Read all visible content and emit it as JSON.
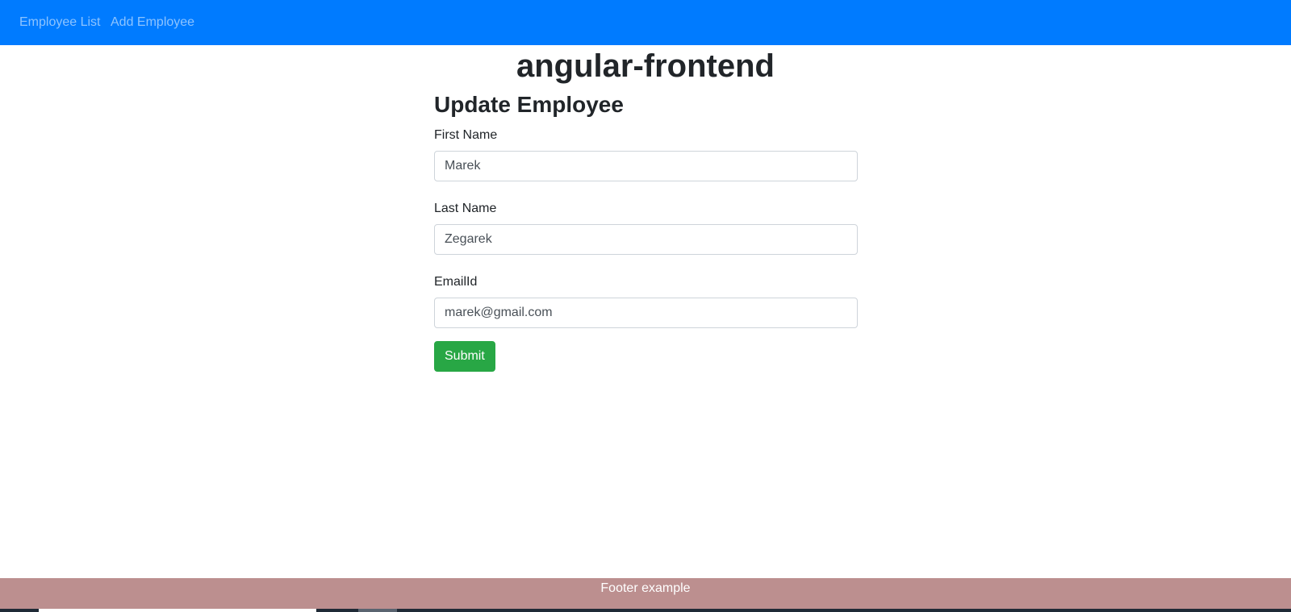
{
  "navbar": {
    "links": [
      {
        "label": "Employee List"
      },
      {
        "label": "Add Employee"
      }
    ],
    "color": "#007bff"
  },
  "app": {
    "title": "angular-frontend"
  },
  "form": {
    "heading": "Update Employee",
    "fields": [
      {
        "label": "First Name",
        "value": "Marek"
      },
      {
        "label": "Last Name",
        "value": "Zegarek"
      },
      {
        "label": "EmailId",
        "value": "marek@gmail.com"
      }
    ],
    "submit_label": "Submit",
    "submit_color": "#28a745"
  },
  "footer": {
    "text": "Footer example",
    "color": "#bc8f8f"
  }
}
